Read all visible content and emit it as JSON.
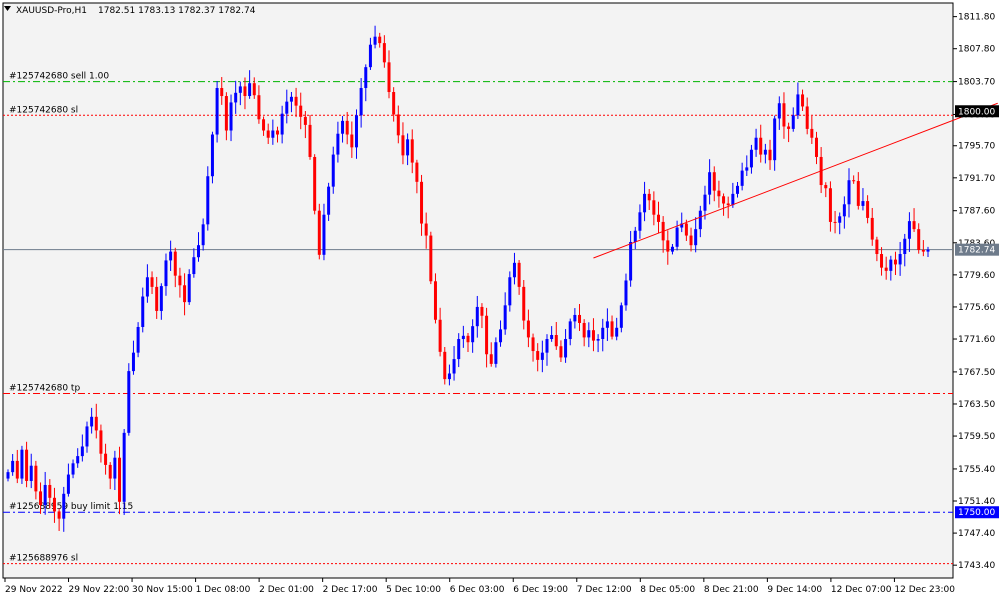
{
  "header": {
    "symbol_label": "XAUUSD-Pro,H1",
    "ohlc_label": "1782.51 1783.13 1782.37 1782.74",
    "menu_icon": "triangle-down-icon"
  },
  "colors": {
    "background": "#f3f3f3",
    "frame": "#000000",
    "bull": "#0000ff",
    "bear": "#ff0000",
    "sell_line": "#00b400",
    "sl_line": "#ff0000",
    "buy_line": "#0000ff",
    "price_line": "#6e7b8b",
    "price_badge": "#000000",
    "badge_text": "#ffffff",
    "trend_line": "#ff0000"
  },
  "chart_data": {
    "type": "candlestick",
    "title": "XAUUSD-Pro,H1",
    "ylim": [
      1741.8,
      1813.5
    ],
    "y_ticks": [
      "1811.80",
      "1807.80",
      "1803.70",
      "1799.60",
      "1795.70",
      "1791.70",
      "1787.60",
      "1783.60",
      "1779.60",
      "1775.60",
      "1771.60",
      "1767.50",
      "1763.50",
      "1759.50",
      "1755.40",
      "1751.40",
      "1747.40",
      "1743.40"
    ],
    "x_ticks": [
      "29 Nov 2022",
      "29 Nov 22:00",
      "30 Nov 15:00",
      "1 Dec 08:00",
      "2 Dec 01:00",
      "2 Dec 17:00",
      "5 Dec 10:00",
      "6 Dec 03:00",
      "6 Dec 19:00",
      "7 Dec 12:00",
      "8 Dec 05:00",
      "8 Dec 21:00",
      "9 Dec 14:00",
      "12 Dec 07:00",
      "12 Dec 23:00"
    ],
    "current_price": "1782.74",
    "price_markers": [
      {
        "value": 1800.0,
        "label": "1800.00"
      },
      {
        "value": 1750.0,
        "label": "1750.00"
      }
    ],
    "order_lines": [
      {
        "label": "#125742680 sell 1.00",
        "value": 1803.7,
        "kind": "sell"
      },
      {
        "label": "#125742680 sl",
        "value": 1799.5,
        "kind": "sl"
      },
      {
        "label": "#125742680 tp",
        "value": 1764.8,
        "kind": "sl"
      },
      {
        "label": "#125688959 buy limit 1.15",
        "value": 1750.0,
        "kind": "buy"
      },
      {
        "label": "#125688976 sl",
        "value": 1743.6,
        "kind": "sl"
      }
    ],
    "trend_lines": [
      {
        "from": [
          126,
          1781.7
        ],
        "to": [
          213,
          1801.0
        ]
      }
    ],
    "closes": [
      1755.0,
      1756.4,
      1754.2,
      1757.8,
      1753.9,
      1755.8,
      1752.6,
      1750.9,
      1753.4,
      1751.8,
      1750.1,
      1749.2,
      1752.3,
      1754.7,
      1756.1,
      1757.0,
      1758.2,
      1760.7,
      1761.9,
      1760.2,
      1757.3,
      1755.9,
      1754.2,
      1756.8,
      1751.3,
      1759.9,
      1767.6,
      1769.9,
      1773.1,
      1776.9,
      1779.3,
      1778.1,
      1775.1,
      1778.2,
      1781.4,
      1782.5,
      1779.5,
      1778.3,
      1776.2,
      1779.7,
      1781.8,
      1783.3,
      1785.9,
      1791.9,
      1797.1,
      1802.9,
      1801.9,
      1797.6,
      1801.1,
      1802.3,
      1803.1,
      1801.9,
      1803.5,
      1802.0,
      1799.0,
      1797.6,
      1796.7,
      1797.6,
      1797.1,
      1799.7,
      1801.2,
      1801.8,
      1800.7,
      1799.3,
      1798.3,
      1794.3,
      1787.6,
      1782.1,
      1787.1,
      1790.6,
      1794.6,
      1797.2,
      1798.8,
      1797.1,
      1795.5,
      1799.5,
      1802.9,
      1805.5,
      1808.3,
      1809.3,
      1808.5,
      1806.1,
      1802.4,
      1799.6,
      1797.0,
      1794.5,
      1796.5,
      1793.6,
      1791.2,
      1786.0,
      1784.5,
      1778.8,
      1774.0,
      1770.0,
      1766.6,
      1767.3,
      1769.1,
      1771.6,
      1772.0,
      1771.2,
      1773.2,
      1775.6,
      1774.5,
      1769.7,
      1768.5,
      1771.2,
      1772.8,
      1775.8,
      1779.3,
      1781.1,
      1778.1,
      1773.9,
      1771.8,
      1770.1,
      1769.0,
      1769.9,
      1771.6,
      1772.1,
      1770.7,
      1769.3,
      1771.6,
      1773.8,
      1774.6,
      1773.6,
      1771.8,
      1772.7,
      1771.4,
      1771.6,
      1773.0,
      1773.8,
      1771.9,
      1773.0,
      1775.8,
      1778.9,
      1783.7,
      1785.1,
      1787.4,
      1789.7,
      1788.9,
      1787.1,
      1786.2,
      1783.9,
      1782.5,
      1783.1,
      1785.5,
      1786.0,
      1784.5,
      1783.3,
      1785.3,
      1787.6,
      1789.6,
      1792.4,
      1790.1,
      1789.4,
      1788.5,
      1788.3,
      1789.7,
      1790.7,
      1792.6,
      1793.0,
      1795.2,
      1796.7,
      1794.6,
      1795.2,
      1793.9,
      1799.1,
      1801.0,
      1798.1,
      1797.8,
      1799.5,
      1802.1,
      1800.6,
      1797.8,
      1796.7,
      1794.3,
      1790.8,
      1790.4,
      1786.2,
      1786.1,
      1786.9,
      1788.4,
      1791.4,
      1791.3,
      1788.2,
      1788.8,
      1786.7,
      1784.0,
      1782.2,
      1780.5,
      1780.1,
      1781.5,
      1780.9,
      1782.2,
      1784.1,
      1786.3,
      1785.3,
      1782.7,
      1782.5,
      1782.74
    ],
    "series_note": "closes are hourly candle closes from left to right"
  }
}
